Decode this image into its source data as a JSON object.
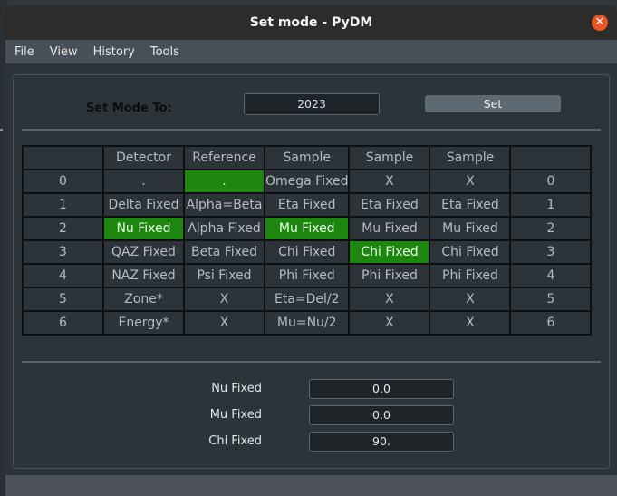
{
  "window": {
    "title": "Set mode - PyDM",
    "close_glyph": "✕"
  },
  "menu": [
    "File",
    "View",
    "History",
    "Tools"
  ],
  "set_mode": {
    "label": "Set Mode To:",
    "value": "2023",
    "button": "Set"
  },
  "table": {
    "header": [
      "",
      "Detector",
      "Reference",
      "Sample",
      "Sample",
      "Sample",
      ""
    ],
    "rows": [
      [
        "0",
        ".",
        ".",
        "Omega Fixed",
        "X",
        "X",
        "0"
      ],
      [
        "1",
        "Delta Fixed",
        "Alpha=Beta",
        "Eta Fixed",
        "Eta Fixed",
        "Eta Fixed",
        "1"
      ],
      [
        "2",
        "Nu Fixed",
        "Alpha Fixed",
        "Mu Fixed",
        "Mu Fixed",
        "Mu Fixed",
        "2"
      ],
      [
        "3",
        "QAZ Fixed",
        "Beta Fixed",
        "Chi Fixed",
        "Chi Fixed",
        "Chi Fixed",
        "3"
      ],
      [
        "4",
        "NAZ Fixed",
        "Psi Fixed",
        "Phi Fixed",
        "Phi Fixed",
        "Phi Fixed",
        "4"
      ],
      [
        "5",
        "Zone*",
        "X",
        "Eta=Del/2",
        "X",
        "X",
        "5"
      ],
      [
        "6",
        "Energy*",
        "X",
        "Mu=Nu/2",
        "X",
        "X",
        "6"
      ]
    ],
    "highlight_color": "#1d860f"
  },
  "fields": [
    {
      "label": "Nu Fixed",
      "value": "0.0"
    },
    {
      "label": "Mu Fixed",
      "value": "0.0"
    },
    {
      "label": "Chi Fixed",
      "value": "90."
    }
  ]
}
